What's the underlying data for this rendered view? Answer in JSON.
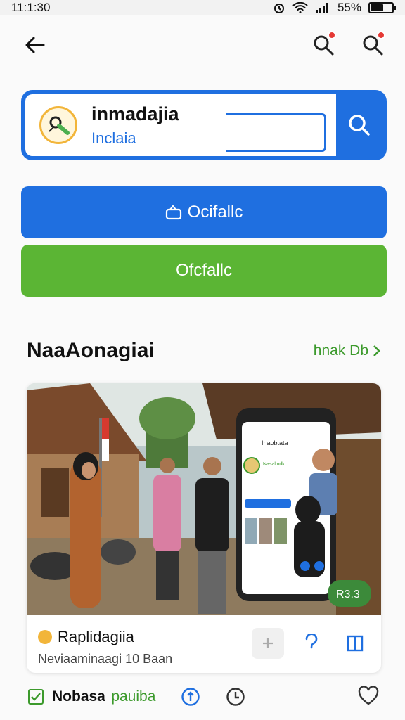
{
  "status_bar": {
    "time": "11:1:30",
    "battery": "55%",
    "battery_level": 0.55
  },
  "search": {
    "title": "inmadajia",
    "subtitle": "Inclaia"
  },
  "buttons": {
    "primary_label": "Ocifallc",
    "secondary_label": "Ofcfallc"
  },
  "section": {
    "title": "NaaAonagiai",
    "link": "hnak Db"
  },
  "photo": {
    "app_title": "Inaobtata",
    "profile_name": "Nasalindk",
    "badge": "R3.3"
  },
  "post": {
    "name": "Raplidagiia",
    "meta": "Neviaaminaagi 10 Baan"
  },
  "bottom": {
    "label": "Nobasa",
    "label2": "pauiba"
  },
  "colors": {
    "accent_blue": "#1f6fe0",
    "accent_green": "#5bb534",
    "notification": "#e53935"
  }
}
